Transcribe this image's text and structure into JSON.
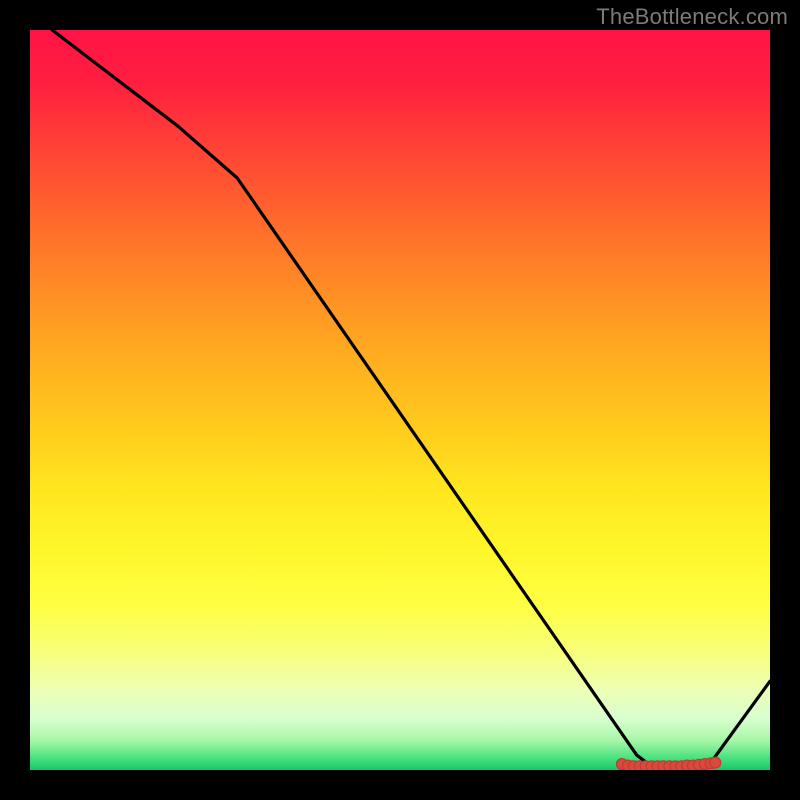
{
  "attribution": "TheBottleneck.com",
  "chart_data": {
    "type": "line",
    "title": "",
    "xlabel": "",
    "ylabel": "",
    "xlim": [
      0,
      100
    ],
    "ylim": [
      0,
      100
    ],
    "line": {
      "x": [
        3,
        20,
        28,
        82,
        84,
        90,
        92,
        100
      ],
      "y": [
        100,
        87,
        80,
        2,
        0.5,
        0.5,
        1,
        12
      ]
    },
    "markers": {
      "x": [
        80,
        80.8,
        81.6,
        82.4,
        83.2,
        84,
        84.8,
        85.6,
        86.4,
        87.2,
        88,
        88.8,
        89.6,
        90.4,
        91.2,
        92,
        92.6
      ],
      "y": [
        0.8,
        0.6,
        0.5,
        0.5,
        0.5,
        0.5,
        0.5,
        0.5,
        0.5,
        0.5,
        0.5,
        0.6,
        0.6,
        0.7,
        0.8,
        0.9,
        1.0
      ]
    },
    "gradient_colors": {
      "top": "#ff1446",
      "mid": "#ffe61f",
      "bottom": "#18c568"
    }
  }
}
